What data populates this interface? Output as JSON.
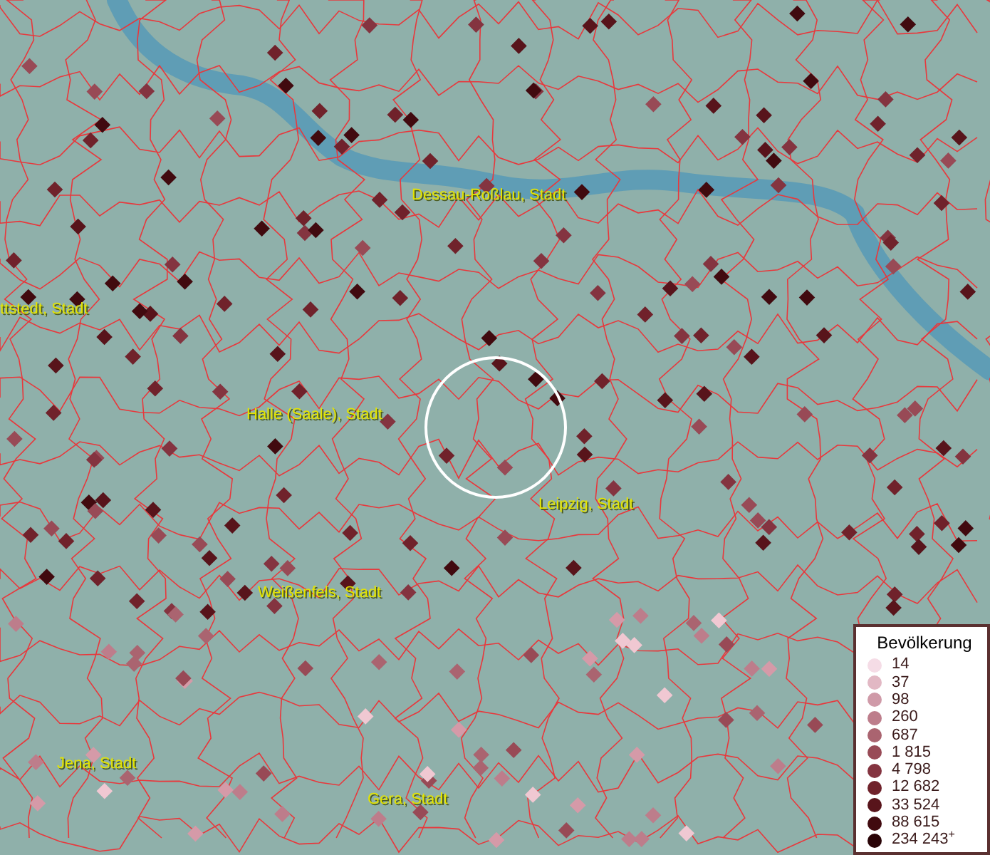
{
  "map": {
    "places": [
      {
        "name": "Dessau-Roßlau, Stadt"
      },
      {
        "name": "ttstedt, Stadt"
      },
      {
        "name": "Halle (Saale), Stadt"
      },
      {
        "name": "Leipzig, Stadt"
      },
      {
        "name": "Weißenfels, Stadt"
      },
      {
        "name": "Jena, Stadt"
      },
      {
        "name": "Gera, Stadt"
      }
    ]
  },
  "legend": {
    "title": "Bevölkerung",
    "classes": [
      {
        "label": "14",
        "color": "#f5dce6"
      },
      {
        "label": "37",
        "color": "#e2b8c4"
      },
      {
        "label": "98",
        "color": "#cf9aa8"
      },
      {
        "label": "260",
        "color": "#bd7d8b"
      },
      {
        "label": "687",
        "color": "#aa6470"
      },
      {
        "label": "1 815",
        "color": "#984a56"
      },
      {
        "label": "4 798",
        "color": "#843440"
      },
      {
        "label": "12 682",
        "color": "#70222b"
      },
      {
        "label": "33 524",
        "color": "#58141b"
      },
      {
        "label": "88 615",
        "color": "#410a0f"
      },
      {
        "label": "234 243$^{+}$",
        "color": "#290306"
      }
    ]
  }
}
